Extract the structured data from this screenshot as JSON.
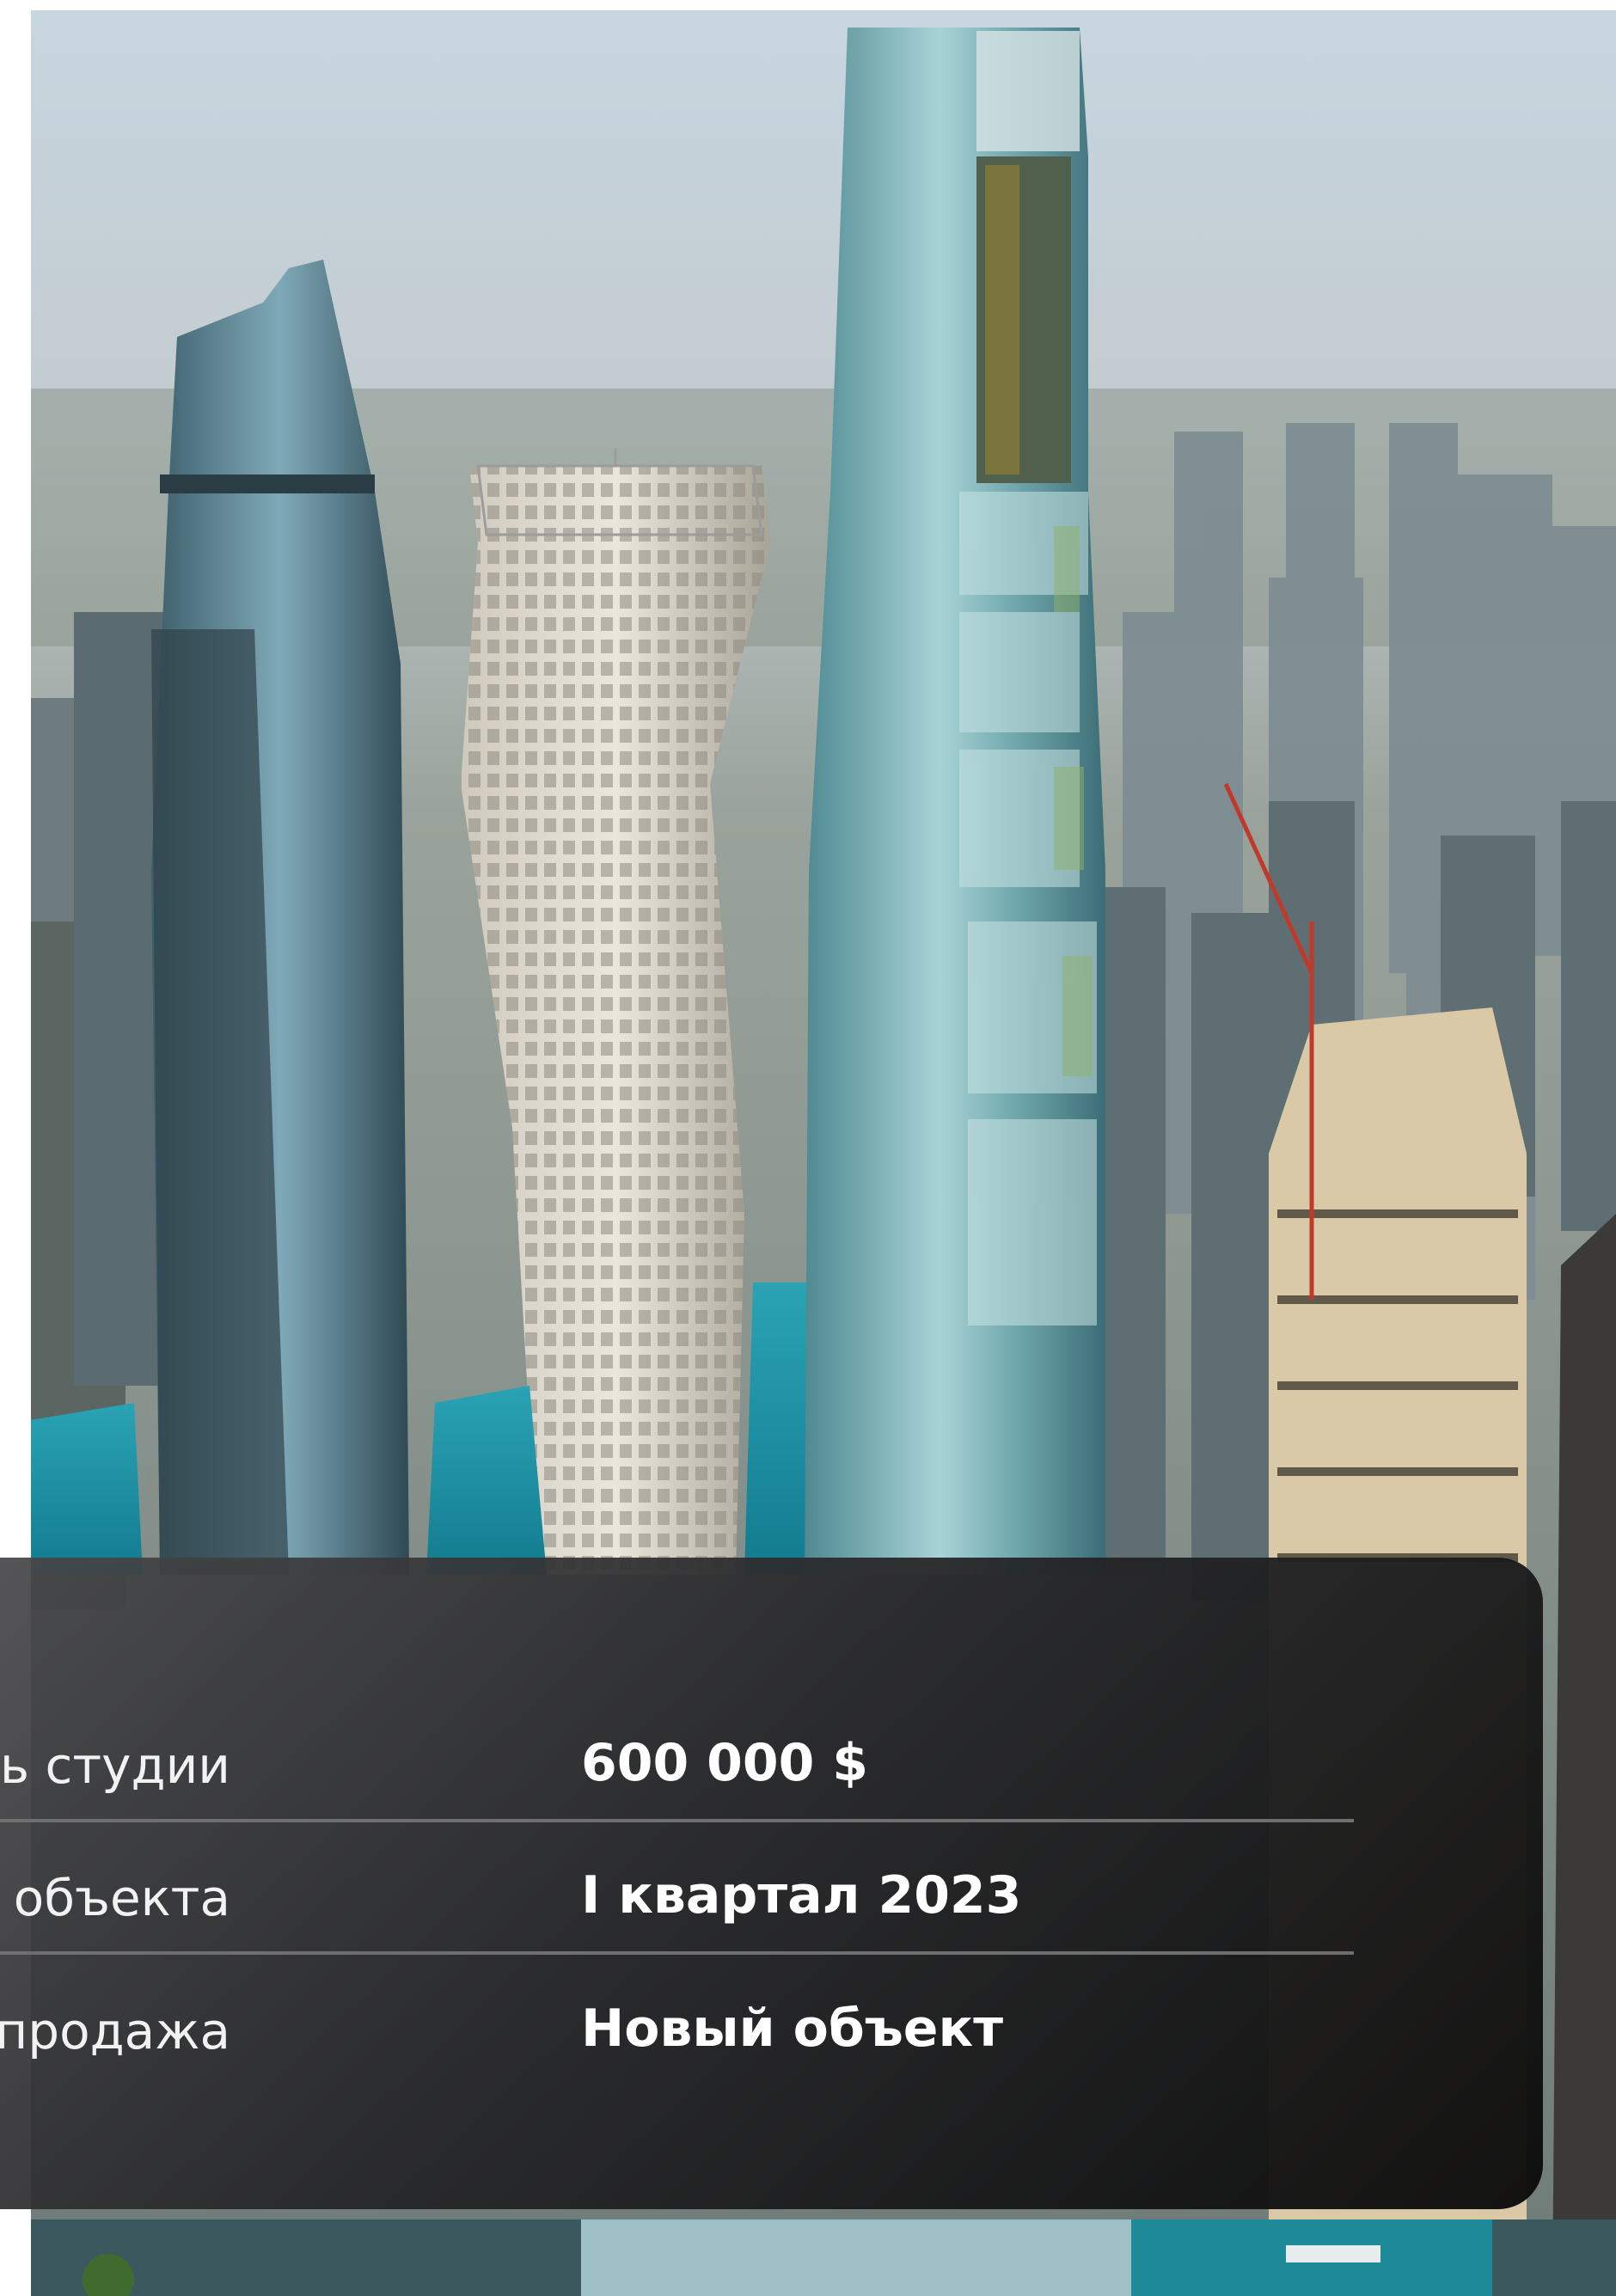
{
  "hero_image": {
    "description_icon": "city-skyline-photo"
  },
  "property_card": {
    "rows": [
      {
        "label": "Стоимость студии",
        "value": "600 000 $"
      },
      {
        "label": "Сроки сдачи объекта",
        "value": "I квартал 2023"
      },
      {
        "label": "Тип продажа",
        "value": "Новый объект"
      }
    ]
  }
}
